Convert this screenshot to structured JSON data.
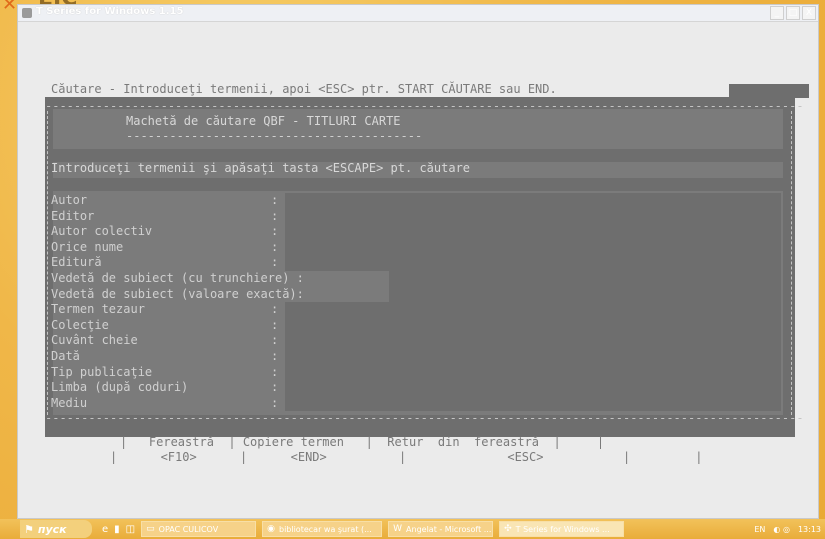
{
  "window": {
    "title": "T Series for Windows 1.15",
    "buttons": [
      "_",
      "□",
      "X"
    ]
  },
  "deco": {
    "x": "✕",
    "hidden_title": "EIC SI"
  },
  "terminal": {
    "prompt": "Căutare - Introduceţi termenii, apoi <ESC> ptr. START CĂUTARE sau END.",
    "border_top": "---------------------------------------------------------------------------------------------------------",
    "border_bottom": "---------------------------------------------------------------------------------------------------------",
    "form_title": "Machetă de căutare QBF - TITLURI CARTE",
    "form_underline": "-----------------------------------------",
    "instruction": "Introduceţi termenii şi apăsaţi tasta <ESCAPE> pt. căutare",
    "fields": [
      {
        "label": "Autor",
        "colon": ":"
      },
      {
        "label": "Editor",
        "colon": ":"
      },
      {
        "label": "Autor colectiv",
        "colon": ":"
      },
      {
        "label": "Orice nume",
        "colon": ":"
      },
      {
        "label": "Editură",
        "colon": ":"
      },
      {
        "label": "Vedetă de subiect (cu trunchiere) :",
        "colon": ""
      },
      {
        "label": "Vedetă de subiect (valoare exactă):",
        "colon": ""
      },
      {
        "label": "Termen tezaur",
        "colon": ":"
      },
      {
        "label": "Colecţie",
        "colon": ":"
      },
      {
        "label": "Cuvânt cheie",
        "colon": ":"
      },
      {
        "label": "Dată",
        "colon": ":"
      },
      {
        "label": "Tip publicaţie",
        "colon": ":"
      },
      {
        "label": "Limba (după coduri)",
        "colon": ":"
      },
      {
        "label": "Mediu",
        "colon": ":"
      }
    ],
    "fkeys_line1": "|   Fereastră  | Copiere termen   |  Retur  din  fereastră  |     |",
    "fkeys_line2": "|      <F10>      |      <END>          |              <ESC>           |         |"
  },
  "taskbar": {
    "start_label": "пуск",
    "quicklaunch": [
      "e",
      "▮",
      "◫"
    ],
    "tasks": [
      {
        "label": "OPAC CULICOV",
        "icon": "folder-icon"
      },
      {
        "label": "bibliotecar wa şurat (...",
        "icon": "browser-icon"
      },
      {
        "label": "Angelat - Microsoft ...",
        "icon": "word-icon"
      },
      {
        "label": "T Series for Windows ...",
        "icon": "app-icon",
        "active": true
      }
    ],
    "tray": {
      "lang": "EN",
      "time": "13:13"
    }
  }
}
